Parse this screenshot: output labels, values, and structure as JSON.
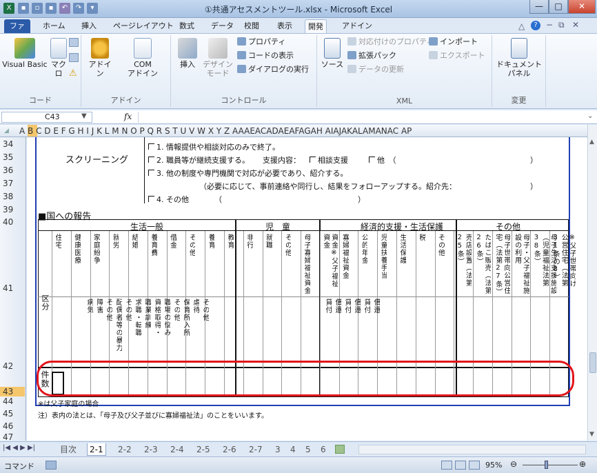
{
  "title": "①共通アセスメントツール.xlsx - Microsoft Excel",
  "tabs": [
    "ファイル",
    "ホーム",
    "挿入",
    "ページレイアウト",
    "数式",
    "データ",
    "校閲",
    "表示",
    "開発",
    "アドイン"
  ],
  "ribbon": {
    "code": {
      "label": "コード",
      "visual_basic": "Visual Basic",
      "macro": "マクロ"
    },
    "addin": {
      "label": "アドイン",
      "addin": "アドイン",
      "com1": "COM",
      "com2": "アドイン"
    },
    "controls": {
      "label": "コントロール",
      "insert": "挿入",
      "design1": "デザイン",
      "design2": "モード",
      "properties": "プロパティ",
      "view_code": "コードの表示",
      "run_dialog": "ダイアログの実行"
    },
    "xml": {
      "label": "XML",
      "source": "ソース",
      "map_props": "対応付けのプロパティ",
      "expansion": "拡張パック",
      "refresh": "データの更新",
      "import": "インポート",
      "export": "エクスポート"
    },
    "modify": {
      "label": "変更",
      "doc_panel1": "ドキュメント",
      "doc_panel2": "パネル"
    }
  },
  "formula_bar": {
    "name_box": "C43",
    "fx": "fx",
    "value": ""
  },
  "columns": "A B C D E F G H I  J  K L M N O P Q R S T U V W X Y Z AAAEACADAEAFAGAH AIAJAKALAMANAC AP",
  "rows": [
    "34",
    "35",
    "36",
    "37",
    "38",
    "39",
    "40",
    "41",
    "42",
    "43",
    "44",
    "45",
    "46",
    "47"
  ],
  "screening": {
    "label": "スクリーニング",
    "opt1": "1. 情報提供や相談対応のみで終了。",
    "opt2": "2. 職員等が継続支援する。",
    "opt2_support": "支援内容：",
    "opt2_consult": "相談支援",
    "opt2_other": "他　（",
    "opt2_close": "）",
    "opt3": "3. 他の制度や専門機関で対応が必要であり、紹介する。",
    "opt3_note": "（必要に応じて、事前連絡や同行し、結果をフォローアップする。紹介先：",
    "opt3_close": "）",
    "opt4": "4. その他",
    "opt4_open": "（",
    "opt4_close": "）"
  },
  "report": {
    "title": "■国への報告",
    "group_life": "生活一般",
    "group_child": "児　童",
    "group_econ": "経済的支援・生活保護",
    "group_other": "その他",
    "kubun": "区分",
    "row_count": "件数",
    "headers_top": [
      "住宅",
      "健康医療",
      "家庭紛争",
      "就労",
      "結婚",
      "養育費",
      "借金",
      "その他",
      "養育",
      "教育",
      "非行",
      "就職",
      "その他",
      "母子寡婦福祉資金",
      "資金※父子福祉資金",
      "寡婦福祉資金",
      "公的年金",
      "児童扶養手当",
      "生活保護",
      "税",
      "その他",
      "売店設置（法第25条）",
      "たばこ販売（法第26条）",
      "母子世帯向公営住宅（法第27条）",
      "母子・父子福祉施設の利用",
      "母子生活支援施設（児童福祉法第38条）",
      "※父子世帯向け公営住宅（法第31条の8）"
    ],
    "headers_sub": [
      "病気",
      "障害",
      "その他",
      "配偶者等の暴力",
      "その他",
      "求職・転職",
      "職業訓練",
      "資格取得・",
      "職場の悩み",
      "その他",
      "保育所入所",
      "虐待",
      "その他",
      "貸付",
      "償還",
      "貸付",
      "償還",
      "貸付",
      "償還"
    ],
    "note1": "※は父子家庭の場合",
    "note2": "注）表内の法とは、「母子及び父子並びに寡婦福祉法」のことをいいます。"
  },
  "sheet_tabs": [
    "目次",
    "2-1",
    "2-2",
    "2-3",
    "2-4",
    "2-5",
    "2-6",
    "2-7",
    "3",
    "4",
    "5",
    "6"
  ],
  "active_sheet": "2-1",
  "status": {
    "mode": "コマンド",
    "zoom": "95%"
  }
}
